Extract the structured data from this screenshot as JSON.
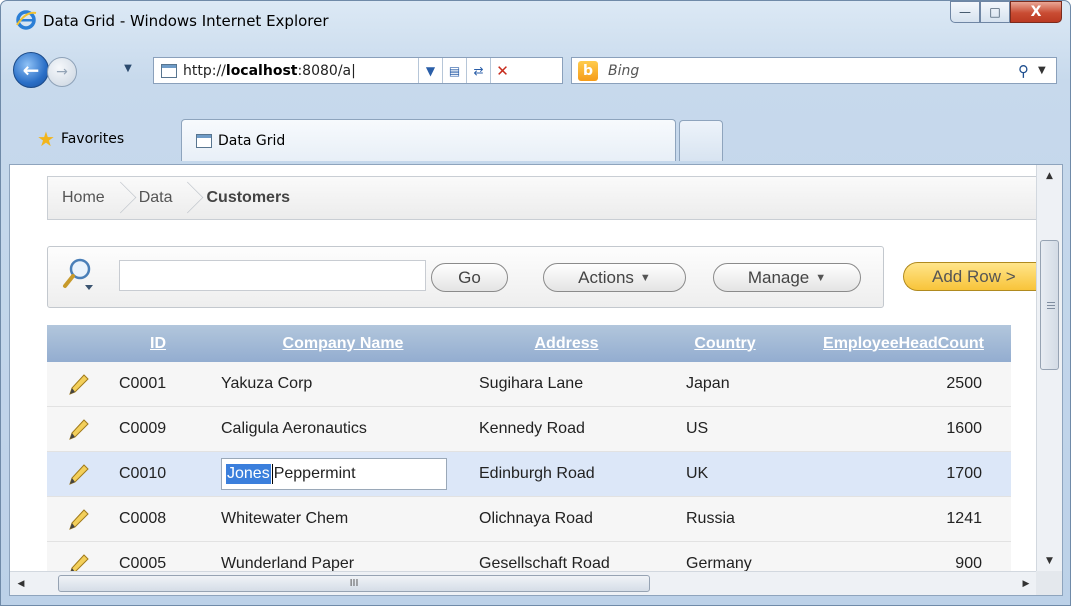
{
  "window": {
    "title": "Data Grid - Windows Internet Explorer",
    "minimize_glyph": "—",
    "maximize_glyph": "□",
    "close_glyph": "X"
  },
  "nav": {
    "address_prefix": "http://",
    "address_host": "localhost",
    "address_suffix": ":8080/a|",
    "search_placeholder": "Bing",
    "back_icon": "back-arrow-icon",
    "forward_icon": "forward-arrow-icon"
  },
  "tabs": {
    "favorites_label": "Favorites",
    "active_tab_label": "Data Grid"
  },
  "breadcrumb": {
    "items": [
      "Home",
      "Data",
      "Customers"
    ]
  },
  "toolbar": {
    "search_value": "",
    "go_label": "Go",
    "actions_label": "Actions",
    "manage_label": "Manage",
    "add_row_label": "Add Row >"
  },
  "grid": {
    "columns": [
      "ID",
      "Company Name",
      "Address",
      "Country",
      "EmployeeHeadCount"
    ],
    "rows": [
      {
        "id": "C0001",
        "company": "Yakuza Corp",
        "address": "Sugihara Lane",
        "country": "Japan",
        "count": "2500"
      },
      {
        "id": "C0009",
        "company": "Caligula Aeronautics",
        "address": "Kennedy Road",
        "country": "US",
        "count": "1600"
      },
      {
        "id": "C0010",
        "company_selected": "Jones",
        "company_rest": "Peppermint",
        "address": "Edinburgh Road",
        "country": "UK",
        "count": "1700"
      },
      {
        "id": "C0008",
        "company": "Whitewater Chem",
        "address": "Olichnaya Road",
        "country": "Russia",
        "count": "1241"
      },
      {
        "id": "C0005",
        "company": "Wunderland Paper",
        "address": "Gesellschaft Road",
        "country": "Germany",
        "count": "900"
      }
    ]
  },
  "scrollbar": {
    "grip_glyph": "III"
  },
  "colors": {
    "grid_header": "#93add0",
    "selected_row": "#dce7f8",
    "add_row_button": "#f8c43a",
    "text_selection": "#3b7fdc"
  }
}
